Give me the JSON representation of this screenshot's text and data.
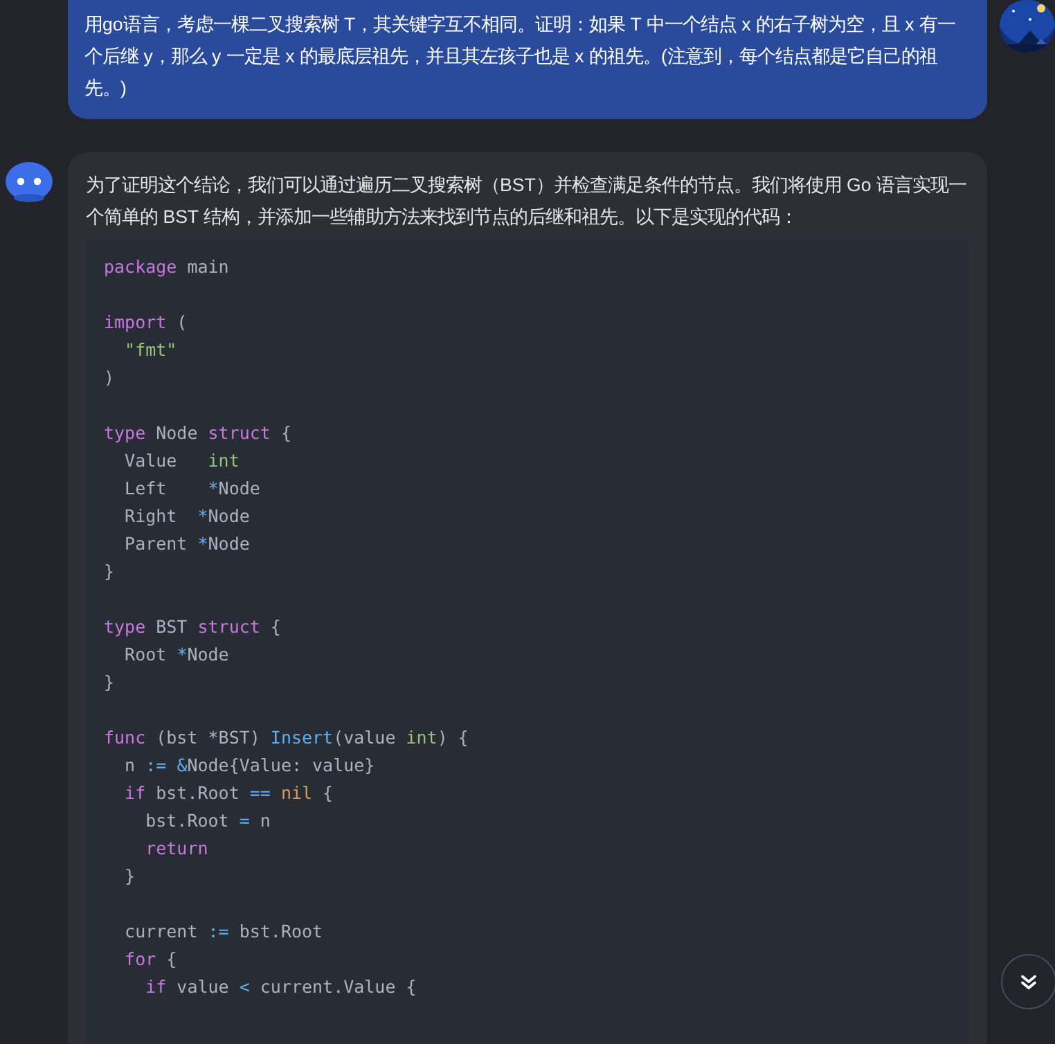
{
  "user_message": {
    "text": "用go语言，考虑一棵二叉搜索树 T，其关键字互不相同。证明：如果 T 中一个结点 x 的右子树为空，且 x 有一个后继 y，那么 y 一定是 x 的最底层祖先，并且其左孩子也是 x 的祖先。(注意到，每个结点都是它自己的祖先。)"
  },
  "assistant_message": {
    "text": "为了证明这个结论，我们可以通过遍历二叉搜索树（BST）并检查满足条件的节点。我们将使用 Go 语言实现一个简单的 BST 结构，并添加一些辅助方法来找到节点的后继和祖先。以下是实现的代码：",
    "code_blocks": [
      [
        [
          {
            "text": "package",
            "kind": "keyword"
          },
          {
            "text": " main",
            "kind": "plain"
          }
        ]
      ],
      [
        [
          {
            "text": "import",
            "kind": "keyword"
          },
          {
            "text": " (",
            "kind": "plain"
          }
        ],
        [
          {
            "text": "  \"fmt\"",
            "kind": "string"
          }
        ],
        [
          {
            "text": ")",
            "kind": "plain"
          }
        ]
      ],
      [
        [
          {
            "text": "type",
            "kind": "keyword"
          },
          {
            "text": " Node ",
            "kind": "plain"
          },
          {
            "text": "struct",
            "kind": "keyword"
          },
          {
            "text": " {",
            "kind": "plain"
          }
        ],
        [
          {
            "text": "  Value   ",
            "kind": "plain"
          },
          {
            "text": "int",
            "kind": "type"
          }
        ],
        [
          {
            "text": "  Left    ",
            "kind": "plain"
          },
          {
            "text": "*",
            "kind": "operator"
          },
          {
            "text": "Node",
            "kind": "plain"
          }
        ],
        [
          {
            "text": "  Right  ",
            "kind": "plain"
          },
          {
            "text": "*",
            "kind": "operator"
          },
          {
            "text": "Node",
            "kind": "plain"
          }
        ],
        [
          {
            "text": "  Parent ",
            "kind": "plain"
          },
          {
            "text": "*",
            "kind": "operator"
          },
          {
            "text": "Node",
            "kind": "plain"
          }
        ],
        [
          {
            "text": "}",
            "kind": "plain"
          }
        ]
      ],
      [
        [
          {
            "text": "type",
            "kind": "keyword"
          },
          {
            "text": " BST ",
            "kind": "plain"
          },
          {
            "text": "struct",
            "kind": "keyword"
          },
          {
            "text": " {",
            "kind": "plain"
          }
        ],
        [
          {
            "text": "  Root ",
            "kind": "plain"
          },
          {
            "text": "*",
            "kind": "operator"
          },
          {
            "text": "Node",
            "kind": "plain"
          }
        ],
        [
          {
            "text": "}",
            "kind": "plain"
          }
        ]
      ],
      [
        [
          {
            "text": "func",
            "kind": "keyword"
          },
          {
            "text": " (bst *BST) ",
            "kind": "plain"
          },
          {
            "text": "Insert",
            "kind": "function"
          },
          {
            "text": "(value ",
            "kind": "plain"
          },
          {
            "text": "int",
            "kind": "type"
          },
          {
            "text": ") {",
            "kind": "plain"
          }
        ],
        [
          {
            "text": "  n ",
            "kind": "plain"
          },
          {
            "text": ":= ",
            "kind": "operator"
          },
          {
            "text": "&",
            "kind": "operator"
          },
          {
            "text": "Node{Value: value}",
            "kind": "plain"
          }
        ],
        [
          {
            "text": "  if",
            "kind": "keyword"
          },
          {
            "text": " bst.Root ",
            "kind": "plain"
          },
          {
            "text": "== ",
            "kind": "operator"
          },
          {
            "text": "nil",
            "kind": "constant"
          },
          {
            "text": " {",
            "kind": "plain"
          }
        ],
        [
          {
            "text": "    bst.Root ",
            "kind": "plain"
          },
          {
            "text": "=",
            "kind": "operator"
          },
          {
            "text": " n",
            "kind": "plain"
          }
        ],
        [
          {
            "text": "    return",
            "kind": "keyword"
          }
        ],
        [
          {
            "text": "  }",
            "kind": "plain"
          }
        ]
      ],
      [
        [
          {
            "text": "  current ",
            "kind": "plain"
          },
          {
            "text": ":=",
            "kind": "operator"
          },
          {
            "text": " bst.Root",
            "kind": "plain"
          }
        ],
        [
          {
            "text": "  for",
            "kind": "keyword"
          },
          {
            "text": " {",
            "kind": "plain"
          }
        ],
        [
          {
            "text": "    if",
            "kind": "keyword"
          },
          {
            "text": " value ",
            "kind": "plain"
          },
          {
            "text": "<",
            "kind": "operator"
          },
          {
            "text": " current.Value {",
            "kind": "plain"
          }
        ]
      ]
    ]
  }
}
